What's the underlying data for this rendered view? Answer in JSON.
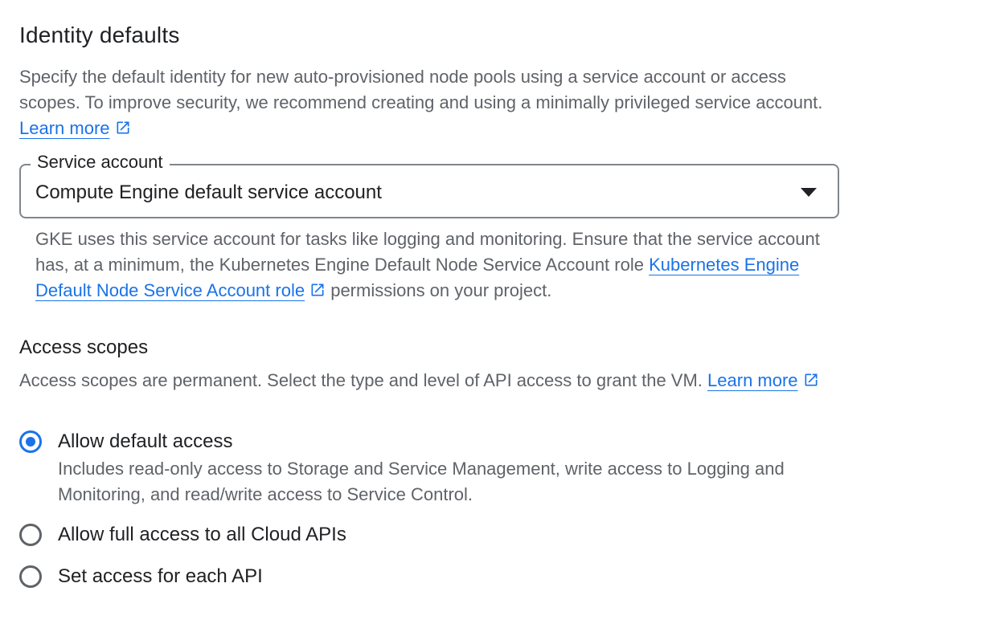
{
  "identity": {
    "title": "Identity defaults",
    "description": "Specify the default identity for new auto-provisioned node pools using a service account or access scopes. To improve security, we recommend creating and using a minimally privileged service account.",
    "learn_more": "Learn more"
  },
  "service_account": {
    "label": "Service account",
    "value": "Compute Engine default service account",
    "hint_before": "GKE uses this service account for tasks like logging and monitoring. Ensure that the service account has, at a minimum, the Kubernetes Engine Default Node Service Account role",
    "hint_link": "Kubernetes Engine Default Node Service Account role",
    "hint_after": "permissions on your project."
  },
  "access_scopes": {
    "title": "Access scopes",
    "description": "Access scopes are permanent. Select the type and level of API access to grant the VM.",
    "learn_more": "Learn more",
    "options": [
      {
        "label": "Allow default access",
        "description": "Includes read-only access to Storage and Service Management, write access to Logging and Monitoring, and read/write access to Service Control.",
        "checked": true
      },
      {
        "label": "Allow full access to all Cloud APIs",
        "checked": false
      },
      {
        "label": "Set access for each API",
        "checked": false
      }
    ]
  },
  "colors": {
    "link": "#1a73e8",
    "radio_selected": "#1a73e8",
    "text_primary": "#202124",
    "text_secondary": "#5f6368",
    "border": "#80868b"
  },
  "icons": {
    "external_link": "open-in-new-icon",
    "dropdown": "arrow-drop-down-icon"
  }
}
